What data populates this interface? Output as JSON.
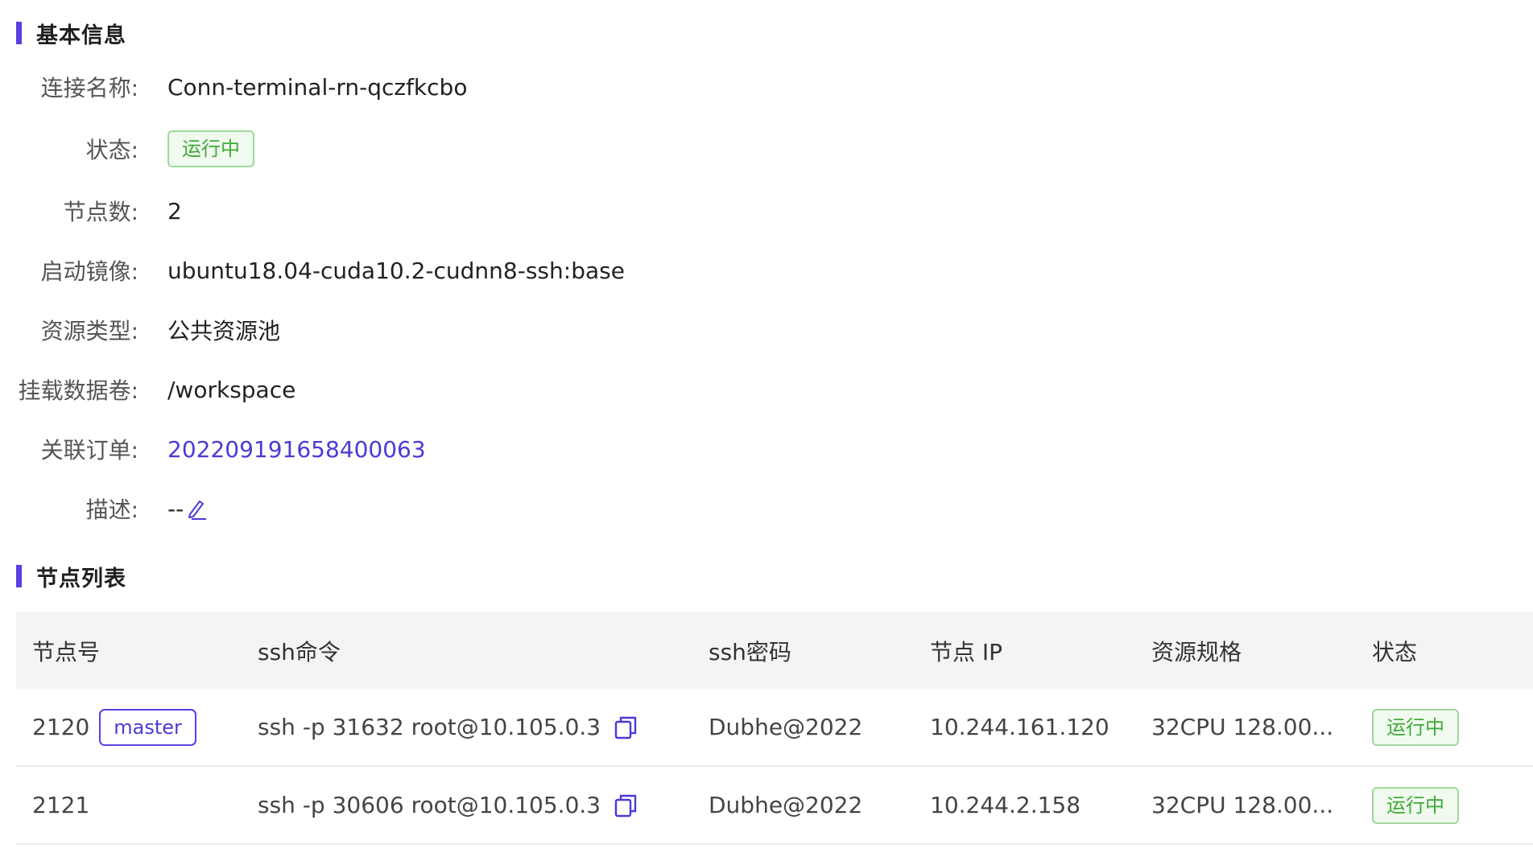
{
  "basic_info": {
    "title": "基本信息",
    "rows": [
      {
        "label": "连接名称:",
        "value": "Conn-terminal-rn-qczfkcbo"
      },
      {
        "label": "状态:",
        "value": "运行中"
      },
      {
        "label": "节点数:",
        "value": "2"
      },
      {
        "label": "启动镜像:",
        "value": "ubuntu18.04-cuda10.2-cudnn8-ssh:base"
      },
      {
        "label": "资源类型:",
        "value": "公共资源池"
      },
      {
        "label": "挂载数据卷:",
        "value": "/workspace"
      },
      {
        "label": "关联订单:",
        "value": "202209191658400063"
      },
      {
        "label": "描述:",
        "value": "--"
      }
    ]
  },
  "node_list": {
    "title": "节点列表",
    "columns": [
      "节点号",
      "ssh命令",
      "ssh密码",
      "节点 IP",
      "资源规格",
      "状态"
    ],
    "rows": [
      {
        "node_id": "2120",
        "tag": "master",
        "ssh_cmd": "ssh -p 31632 root@10.105.0.3",
        "ssh_pwd": "Dubhe@2022",
        "ip": "10.244.161.120",
        "spec": "32CPU 128.00...",
        "status": "运行中"
      },
      {
        "node_id": "2121",
        "tag": "",
        "ssh_cmd": "ssh -p 30606 root@10.105.0.3",
        "ssh_pwd": "Dubhe@2022",
        "ip": "10.244.2.158",
        "spec": "32CPU 128.00...",
        "status": "运行中"
      }
    ]
  },
  "colors": {
    "accent": "#5b3fe0",
    "link": "#4a3ad6",
    "status_green": "#3faa38",
    "header_bg": "#f3f4f6"
  },
  "icons": {
    "description_edit": "edit-icon",
    "ssh_copy": "copy-icon"
  }
}
